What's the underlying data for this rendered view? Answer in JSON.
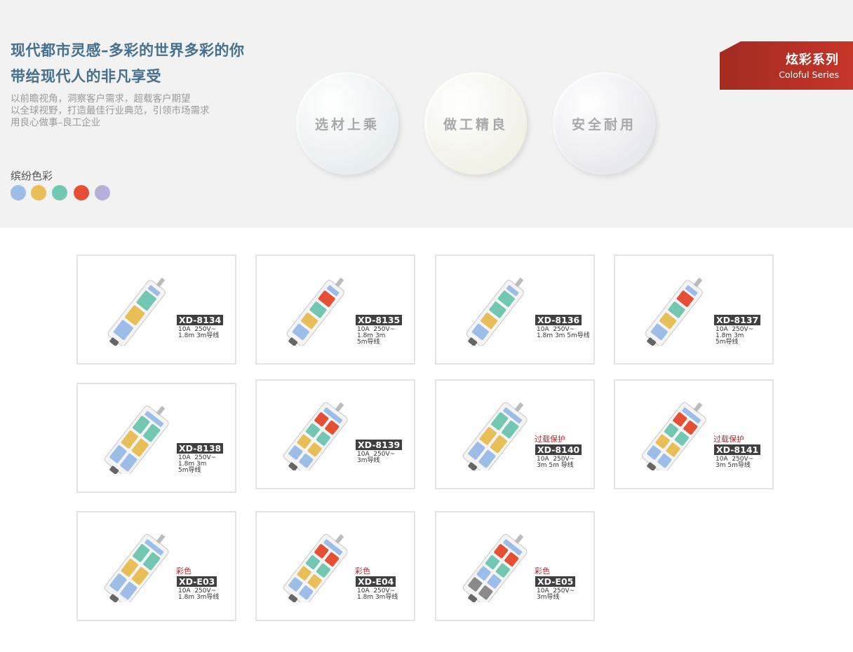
{
  "header": {
    "headline_1": "现代都市灵感–多彩的世界多彩的你",
    "headline_2": "带给现代人的非凡享受",
    "desc_lines": [
      "以前瞻视角，洞察客户需求，超载客户期望",
      "以全球视野，打造最佳行业典范，引领市场需求",
      "用良心做事–良工企业"
    ],
    "colors_label": "缤纷色彩",
    "swatches": [
      "#9bbde8",
      "#e8be57",
      "#72c7b3",
      "#e55035",
      "#b6b0d8"
    ],
    "features": [
      "选材上乘",
      "做工精良",
      "安全耐用"
    ],
    "feature_tints": [
      "#e8eeef",
      "#f1f1e6",
      "#e8e8ef"
    ],
    "badge_title": "炫彩系列",
    "badge_subtitle": "Coloful Series",
    "badge_color": "#b3302a"
  },
  "products": [
    {
      "model": "XD-8134",
      "tag": "",
      "spec": "10A  250V~\n1.8m 3m导线"
    },
    {
      "model": "XD-8135",
      "tag": "",
      "spec": "10A  250V~\n1.8m 3m\n5m导线"
    },
    {
      "model": "XD-8136",
      "tag": "",
      "spec": "10A  250V~\n1.8m 3m 5m导线"
    },
    {
      "model": "XD-8137",
      "tag": "",
      "spec": "10A  250V~\n1.8m 3m\n5m导线"
    },
    {
      "model": "XD-8138",
      "tag": "",
      "spec": "10A  250V~\n1.8m 3m\n5m导线"
    },
    {
      "model": "XD-8139",
      "tag": "",
      "spec": "10A  250V~\n3m导线"
    },
    {
      "model": "XD-8140",
      "tag": "过载保护",
      "spec": "10A  250V~\n3m 5m 导线"
    },
    {
      "model": "XD-8141",
      "tag": "过载保护",
      "spec": "10A  250V~\n3m 5m导线"
    },
    {
      "model": "XD-E03",
      "tag": "彩色",
      "spec": "10A  250V~\n1.8m 3m导线"
    },
    {
      "model": "XD-E04",
      "tag": "彩色",
      "spec": "10A  250V~\n1.8m 3m导线"
    },
    {
      "model": "XD-E05",
      "tag": "彩色",
      "spec": "10A  250V~\n3m导线"
    }
  ]
}
